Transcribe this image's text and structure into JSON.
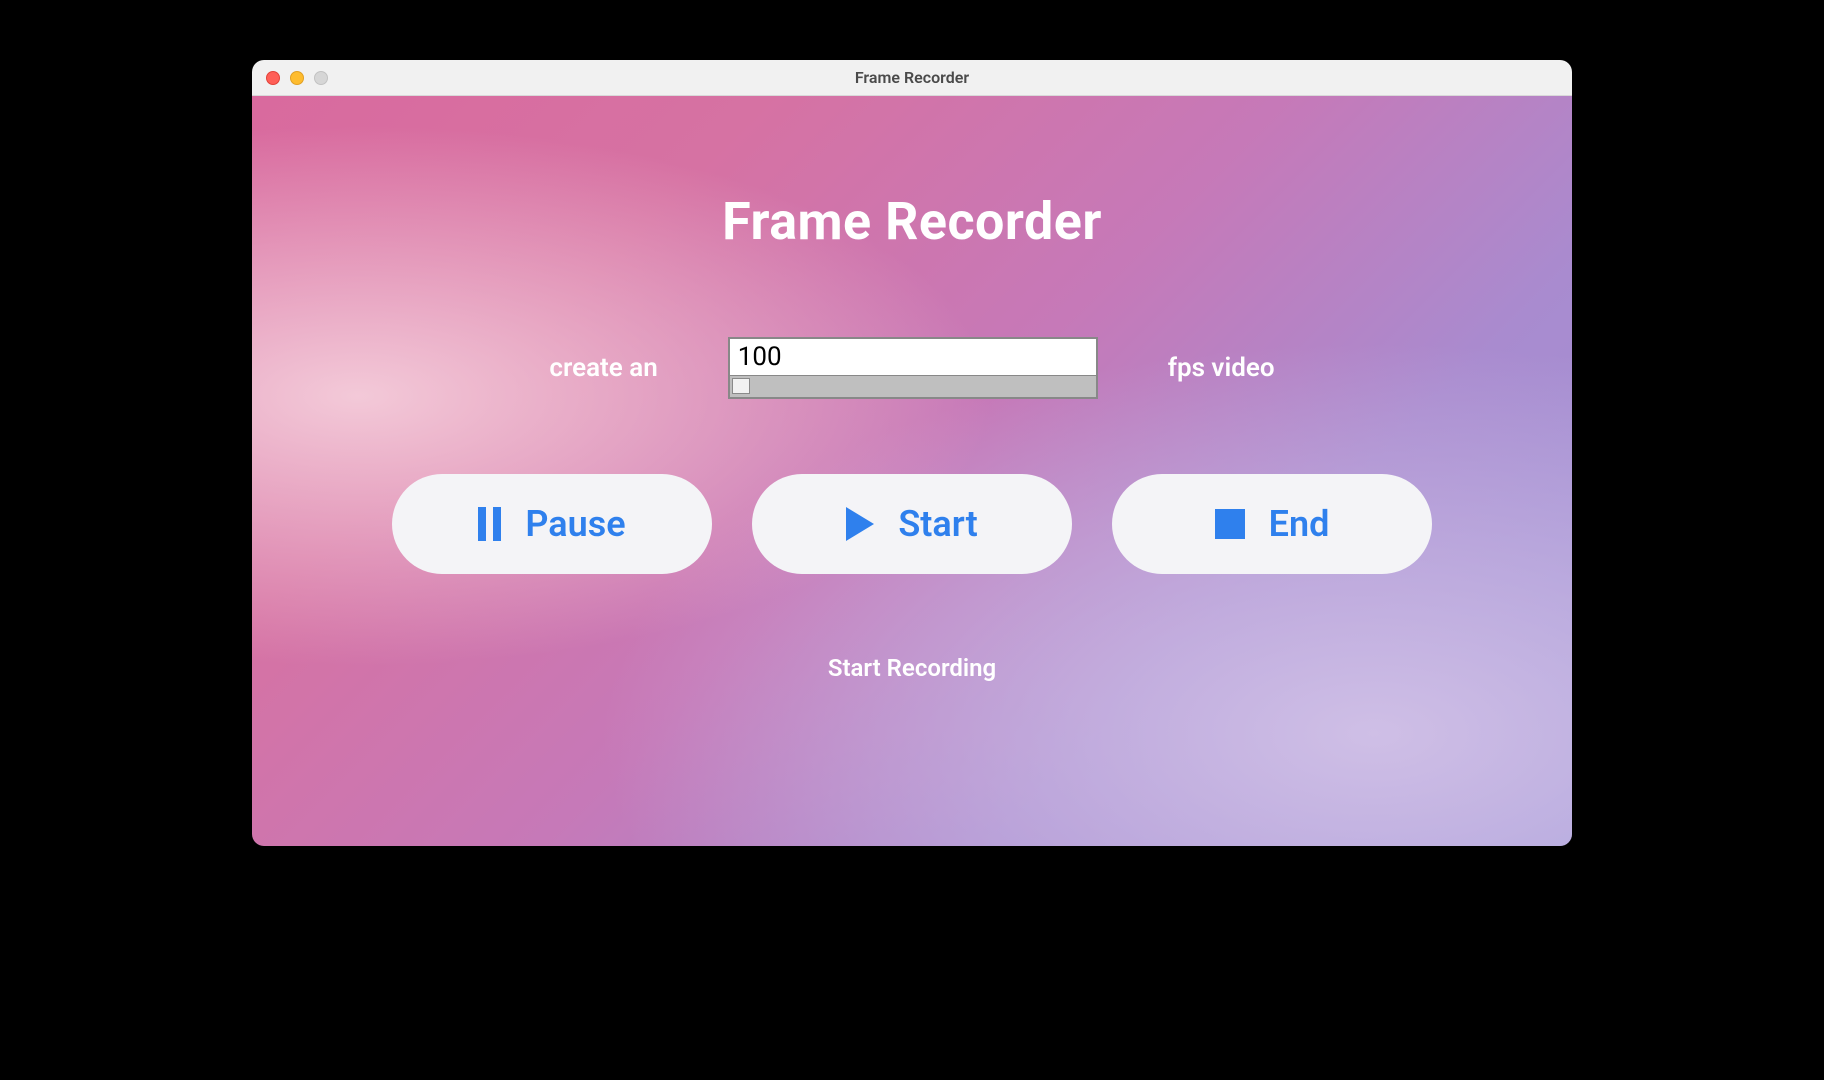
{
  "window": {
    "title": "Frame Recorder"
  },
  "app": {
    "title": "Frame Recorder"
  },
  "fps": {
    "prefix_label": "create an",
    "value": "100",
    "suffix_label": "fps video"
  },
  "buttons": {
    "pause": {
      "label": "Pause",
      "icon": "pause-icon"
    },
    "start": {
      "label": "Start",
      "icon": "play-icon"
    },
    "end": {
      "label": "End",
      "icon": "stop-icon"
    }
  },
  "status": {
    "text": "Start Recording"
  },
  "colors": {
    "accent": "#2f80ed",
    "button_bg": "#f4f4f7",
    "text_light": "#ffffff"
  }
}
